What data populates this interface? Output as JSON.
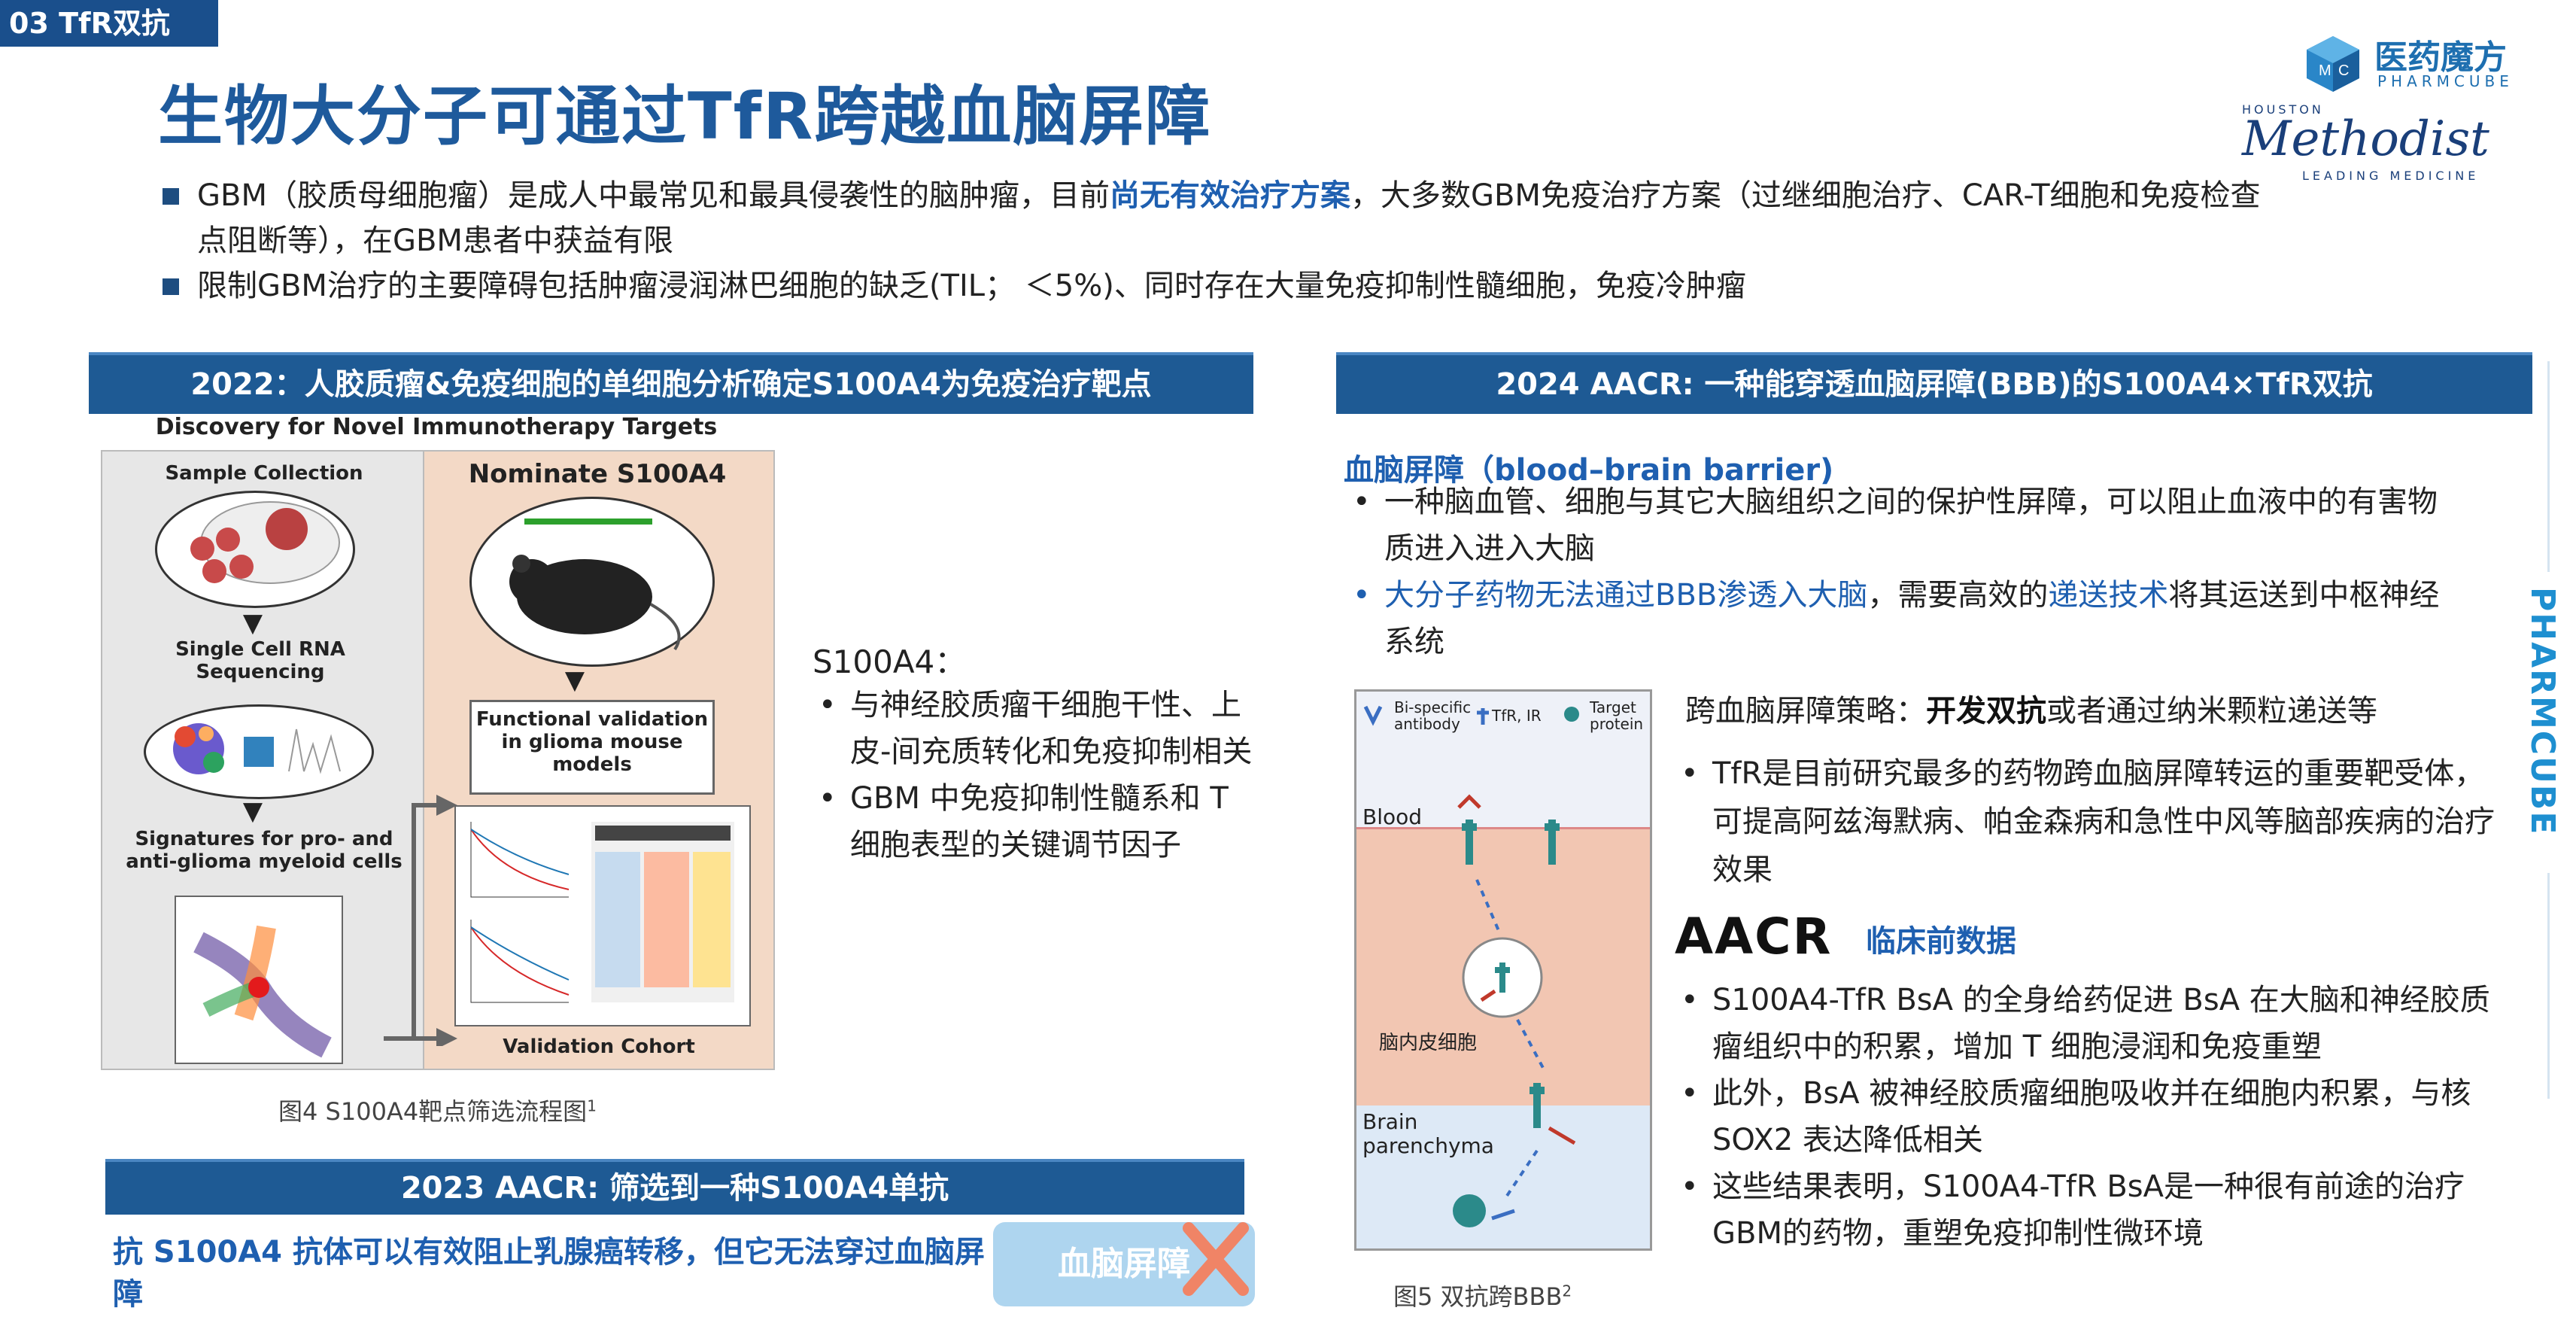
{
  "section_tag": "03 TfR双抗",
  "title": "生物大分子可通过TfR跨越血脑屏障",
  "logos": {
    "pharmcube_cn": "医药魔方",
    "pharmcube_en": "PHARMCUBE",
    "methodist_top": "HOUSTON",
    "methodist_name": "Methodist",
    "methodist_sub": "LEADING MEDICINE"
  },
  "intro": {
    "b1_pre": "GBM（胶质母细胞瘤）是成人中最常见和最具侵袭性的脑肿瘤，目前",
    "b1_hl": "尚无有效治疗方案",
    "b1_post": "，大多数GBM免疫治疗方案（过继细胞治疗、CAR-T细胞和免疫检查点阻断等），在GBM患者中获益有限",
    "b2": "限制GBM治疗的主要障碍包括肿瘤浸润淋巴细胞的缺乏(TIL； ＜5%)、同时存在大量免疫抑制性髓细胞，免疫冷肿瘤"
  },
  "band_2022": "2022：人胶质瘤&免疫细胞的单细胞分析确定S100A4为免疫治疗靶点",
  "band_2024": "2024 AACR: 一种能穿透血脑屏障(BBB)的S100A4×TfR双抗",
  "band_2023": "2023 AACR: 筛选到一种S100A4单抗",
  "fig4": {
    "header": "Discovery for Novel Immunotherapy Targets",
    "sample": "Sample Collection",
    "scrna": "Single Cell RNA Sequencing",
    "signatures": "Signatures for pro- and anti-glioma myeloid cells",
    "nominate": "Nominate S100A4",
    "functional": "Functional validation in glioma mouse models",
    "validation": "Validation Cohort",
    "caption": "图4 S100A4靶点筛选流程图",
    "caption_sup": "1"
  },
  "s100a4": {
    "title": "S100A4：",
    "items": [
      "与神经胶质瘤干细胞干性、上皮-间充质转化和免疫抑制相关",
      " GBM 中免疫抑制性髓系和 T 细胞表型的关键调节因子"
    ]
  },
  "bottom": {
    "text": "抗 S100A4 抗体可以有效阻止乳腺癌转移，但它无法穿过血脑屏障",
    "badge": "血脑屏障"
  },
  "bbb": {
    "head": "血脑屏障（blood–brain barrier)",
    "item1": "一种脑血管、细胞与其它大脑组织之间的保护性屏障，可以阻止血液中的有害物质进入进入大脑",
    "item2_a": "大分子药物无法通过BBB渗透入大脑",
    "item2_b": "，需要高效的",
    "item2_c": "递送技术",
    "item2_d": "将其运送到中枢神经系统"
  },
  "fig5": {
    "legend_bsa": "Bi-specific antibody",
    "legend_tfr": "TfR, IR",
    "legend_target": "Target protein",
    "blood": "Blood",
    "endo": "脑内皮细胞",
    "brain": "Brain parenchyma",
    "caption": "图5 双抗跨BBB",
    "caption_sup": "2"
  },
  "strategy": {
    "pre": "跨血脑屏障策略：",
    "bold": "开发双抗",
    "post": "或者通过纳米颗粒递送等"
  },
  "tfr_item": "TfR是目前研究最多的药物跨血脑屏障转运的重要靶受体，可提高阿兹海默病、帕金森病和急性中风等脑部疾病的治疗效果",
  "aacr_logo": "AACR",
  "aacr_sub": "临床前数据",
  "results": [
    "S100A4-TfR BsA 的全身给药促进 BsA 在大脑和神经胶质瘤组织中的积累，增加 T 细胞浸润和免疫重塑",
    "此外，BsA 被神经胶质瘤细胞吸收并在细胞内积累，与核 SOX2 表达降低相关",
    "这些结果表明，S100A4-TfR BsA是一种很有前途的治疗GBM的药物，重塑免疫抑制性微环境"
  ],
  "side_brand": "PHARMCUBE"
}
